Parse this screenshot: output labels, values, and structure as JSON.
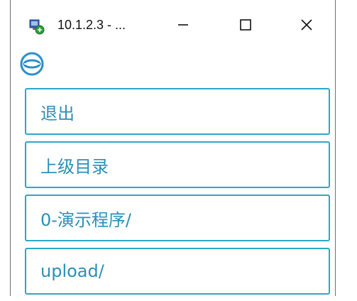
{
  "window": {
    "title": "10.1.2.3 - ...",
    "controls": {
      "minimize_icon": "minimize-icon",
      "maximize_icon": "maximize-icon",
      "close_icon": "close-icon"
    }
  },
  "app": {
    "logo_icon": "app-logo-icon",
    "accent_color": "#2aa8c9"
  },
  "list": {
    "items": [
      {
        "label": "退出"
      },
      {
        "label": "上级目录"
      },
      {
        "label": "0-演示程序/"
      },
      {
        "label": "upload/"
      }
    ]
  }
}
